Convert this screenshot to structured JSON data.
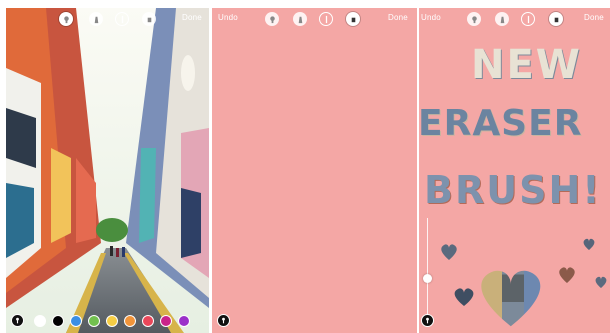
{
  "panels": {
    "photo": {
      "toolbar": {
        "done_label": "Done",
        "icons": [
          "pen-icon",
          "marker-icon",
          "neon-icon",
          "eraser-icon"
        ]
      },
      "palette": [
        "#ffffff",
        "#000000",
        "#3b8fe5",
        "#72c04f",
        "#f6cd45",
        "#f1943a",
        "#e9475a",
        "#c9238a",
        "#9b31c9"
      ]
    },
    "pink": {
      "toolbar": {
        "undo_label": "Undo",
        "done_label": "Done"
      }
    },
    "art": {
      "toolbar": {
        "undo_label": "Undo",
        "done_label": "Done"
      },
      "art_text": [
        "NEW",
        "ERASER",
        "BRUSH!"
      ]
    }
  },
  "colors": {
    "canvas_pink": "#f4a7a5"
  }
}
